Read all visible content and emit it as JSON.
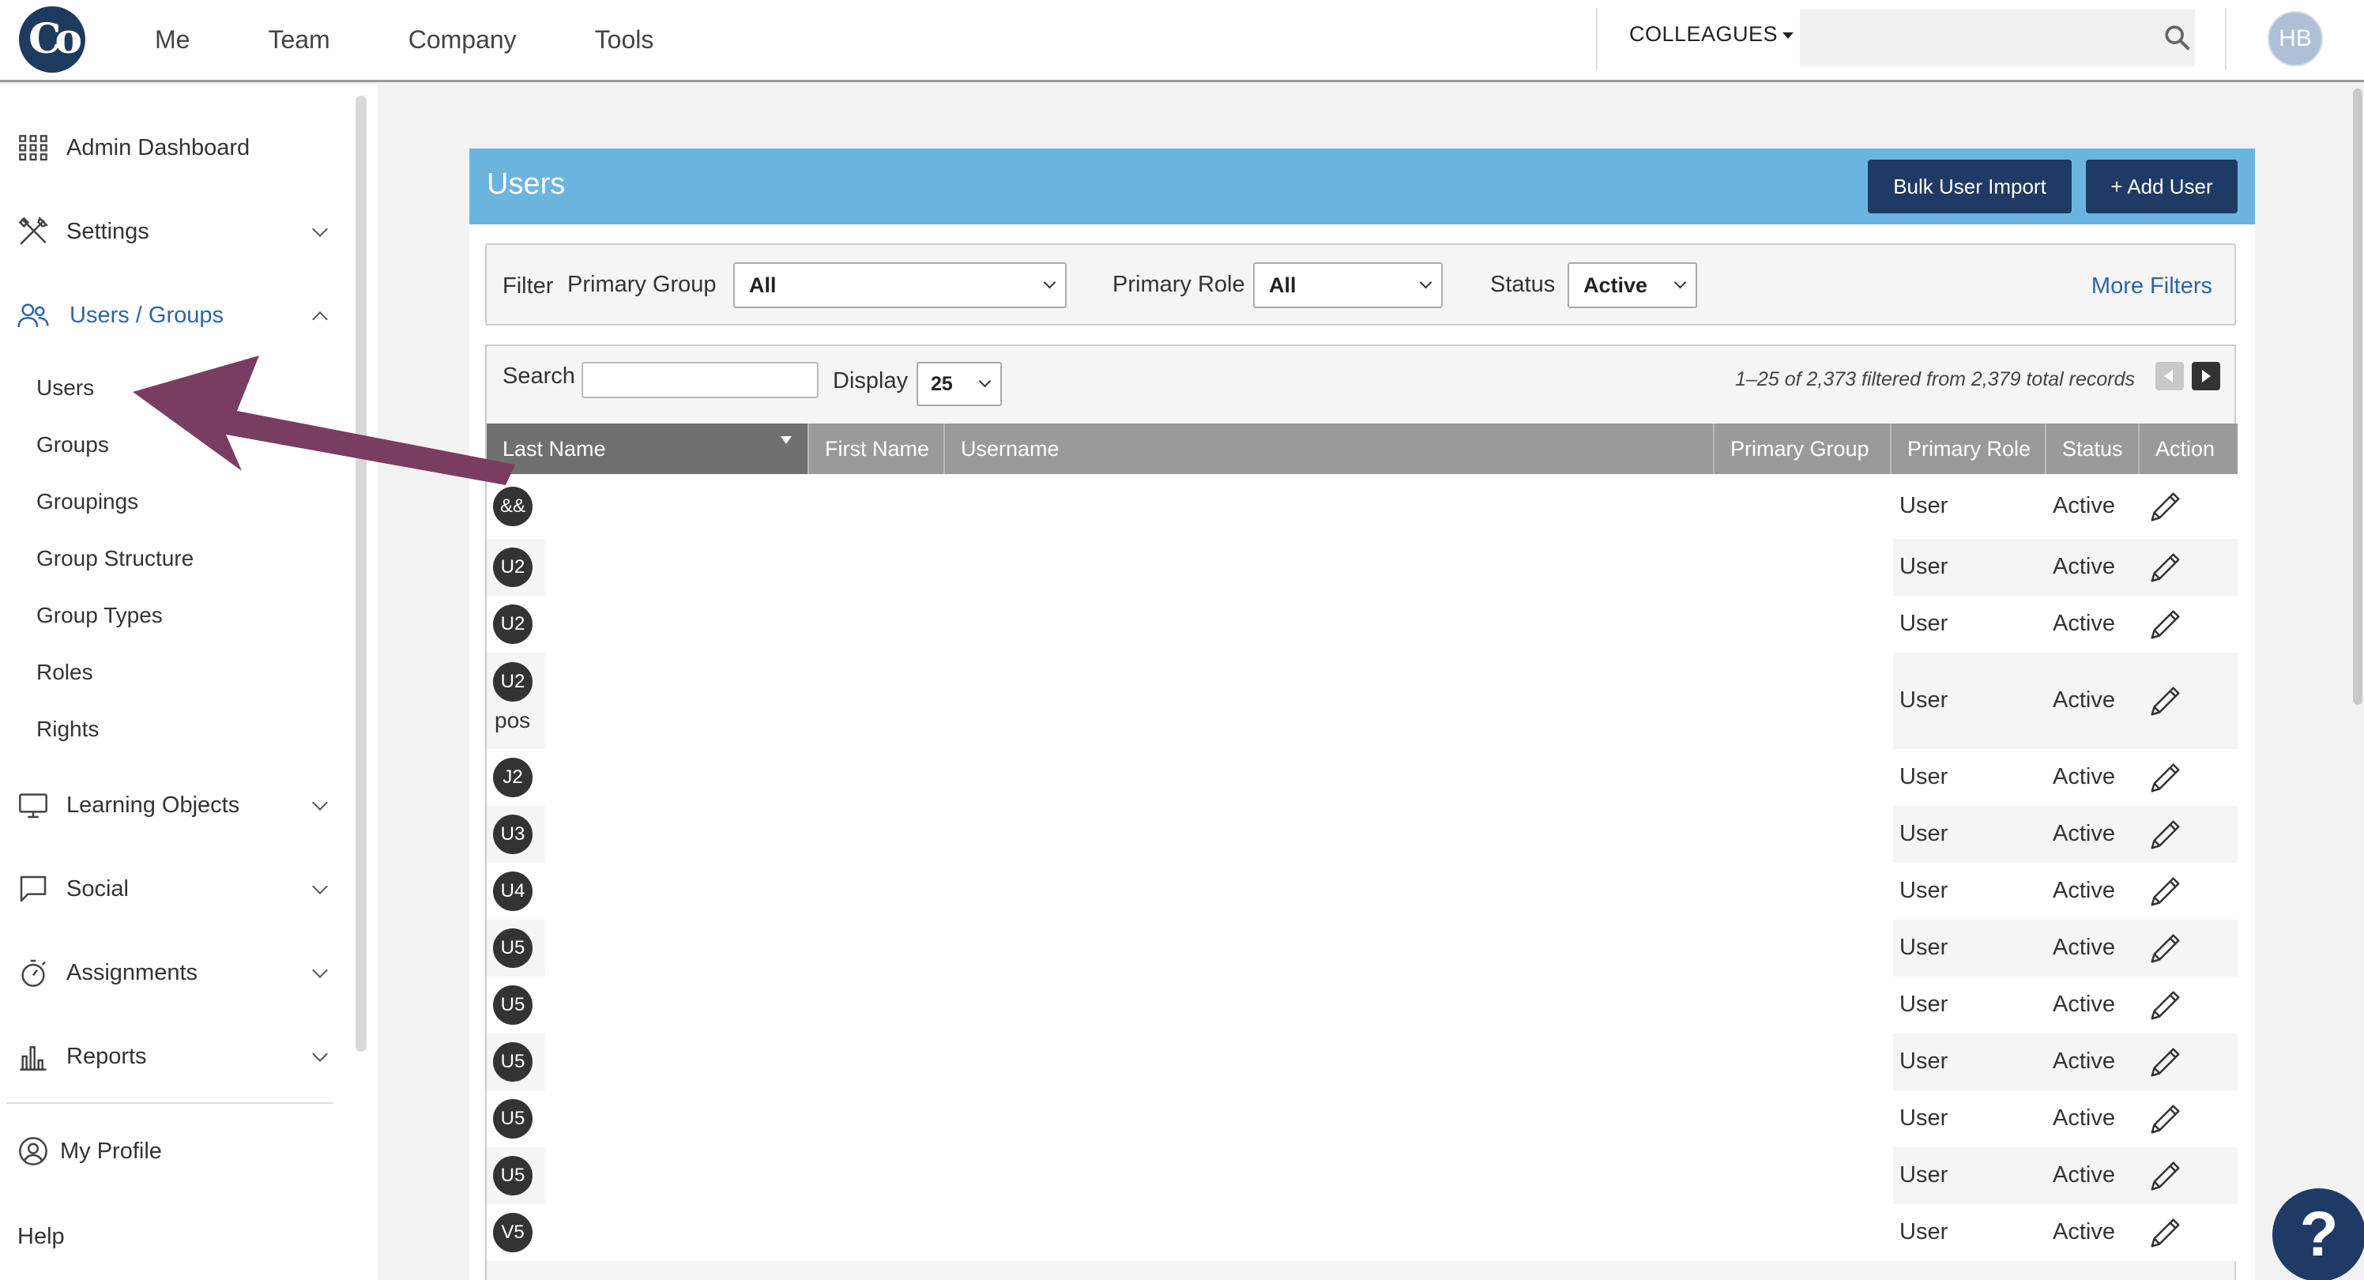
{
  "topnav": {
    "items": [
      "Me",
      "Team",
      "Company",
      "Tools"
    ],
    "colleagues_label": "COLLEAGUES",
    "avatar_initials": "HB",
    "logo_text": "Co"
  },
  "sidebar": {
    "admin_dashboard": "Admin Dashboard",
    "settings": "Settings",
    "users_groups": "Users / Groups",
    "sub_items": [
      "Users",
      "Groups",
      "Groupings",
      "Group Structure",
      "Group Types",
      "Roles",
      "Rights"
    ],
    "learning_objects": "Learning Objects",
    "social": "Social",
    "assignments": "Assignments",
    "reports": "Reports",
    "my_profile": "My Profile",
    "help": "Help"
  },
  "panel": {
    "title": "Users",
    "bulk_import": "Bulk User Import",
    "add_user": "+ Add User"
  },
  "filters": {
    "filter_label": "Filter",
    "primary_group_label": "Primary Group",
    "primary_group_value": "All",
    "primary_role_label": "Primary Role",
    "primary_role_value": "All",
    "status_label": "Status",
    "status_value": "Active",
    "more_filters": "More Filters"
  },
  "table": {
    "search_label": "Search",
    "display_label": "Display",
    "display_value": "25",
    "records_text": "1–25 of 2,373 filtered from 2,379 total records",
    "columns": [
      "Last Name",
      "First Name",
      "Username",
      "Primary Group",
      "Primary Role",
      "Status",
      "Action"
    ],
    "rows": [
      {
        "badge": "&&",
        "sub": "",
        "role": "User",
        "status": "Active"
      },
      {
        "badge": "U2",
        "sub": "",
        "role": "User",
        "status": "Active"
      },
      {
        "badge": "U2",
        "sub": "",
        "role": "User",
        "status": "Active"
      },
      {
        "badge": "U2",
        "sub": "pos",
        "role": "User",
        "status": "Active"
      },
      {
        "badge": "J2",
        "sub": "",
        "role": "User",
        "status": "Active"
      },
      {
        "badge": "U3",
        "sub": "",
        "role": "User",
        "status": "Active"
      },
      {
        "badge": "U4",
        "sub": "",
        "role": "User",
        "status": "Active"
      },
      {
        "badge": "U5",
        "sub": "",
        "role": "User",
        "status": "Active"
      },
      {
        "badge": "U5",
        "sub": "",
        "role": "User",
        "status": "Active"
      },
      {
        "badge": "U5",
        "sub": "",
        "role": "User",
        "status": "Active"
      },
      {
        "badge": "U5",
        "sub": "",
        "role": "User",
        "status": "Active"
      },
      {
        "badge": "U5",
        "sub": "",
        "role": "User",
        "status": "Active"
      },
      {
        "badge": "V5",
        "sub": "",
        "role": "User",
        "status": "Active"
      }
    ]
  },
  "help_button": "?",
  "colors": {
    "header_blue": "#6cb4e0",
    "button_navy": "#1f3a64",
    "arrow_purple": "#7a3d62",
    "link_blue": "#2d64a8"
  }
}
